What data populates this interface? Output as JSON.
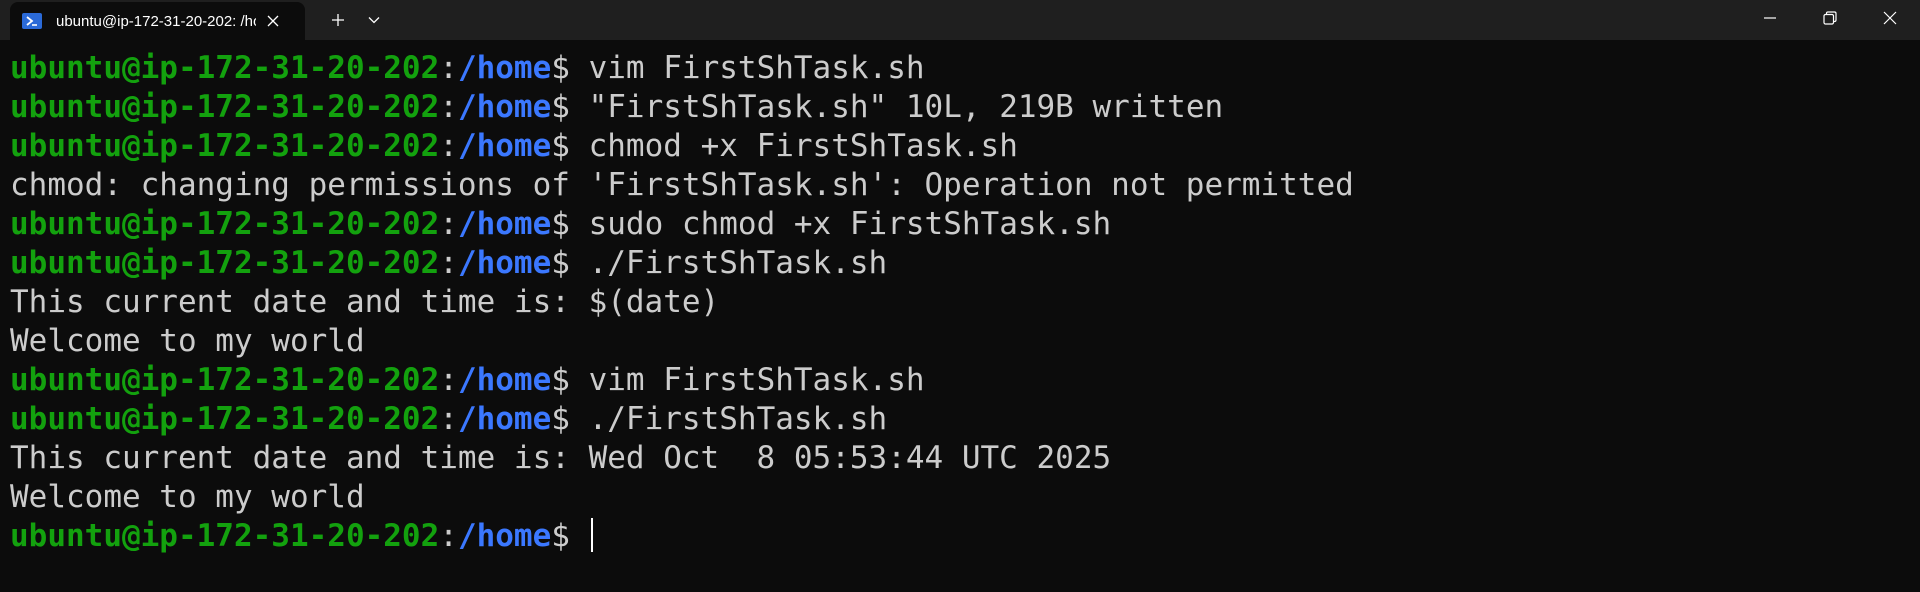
{
  "tab": {
    "title": "ubuntu@ip-172-31-20-202: /home",
    "icon": "powershell-icon",
    "close_icon": "close-icon"
  },
  "titlebar": {
    "add_icon": "plus-icon",
    "dropdown_icon": "chevron-down-icon",
    "minimize_icon": "minimize-icon",
    "restore_icon": "restore-icon",
    "close_icon": "close-icon"
  },
  "colors": {
    "user": "#13a10e",
    "path": "#3b78ff",
    "text": "#cccccc",
    "background": "#0c0c0c"
  },
  "terminal": {
    "user": "ubuntu@ip-172-31-20-202",
    "path": "/home",
    "lines": [
      {
        "type": "prompt",
        "cmd": "vim FirstShTask.sh"
      },
      {
        "type": "prompt",
        "cmd": "\"FirstShTask.sh\" 10L, 219B written"
      },
      {
        "type": "prompt",
        "cmd": "chmod +x FirstShTask.sh"
      },
      {
        "type": "output",
        "text": "chmod: changing permissions of 'FirstShTask.sh': Operation not permitted"
      },
      {
        "type": "prompt",
        "cmd": "sudo chmod +x FirstShTask.sh"
      },
      {
        "type": "prompt",
        "cmd": "./FirstShTask.sh"
      },
      {
        "type": "output",
        "text": "This current date and time is: $(date)"
      },
      {
        "type": "output",
        "text": "Welcome to my world"
      },
      {
        "type": "prompt",
        "cmd": "vim FirstShTask.sh"
      },
      {
        "type": "prompt",
        "cmd": "./FirstShTask.sh"
      },
      {
        "type": "output",
        "text": "This current date and time is: Wed Oct  8 05:53:44 UTC 2025"
      },
      {
        "type": "output",
        "text": "Welcome to my world"
      },
      {
        "type": "prompt",
        "cmd": "",
        "cursor": true
      }
    ]
  }
}
